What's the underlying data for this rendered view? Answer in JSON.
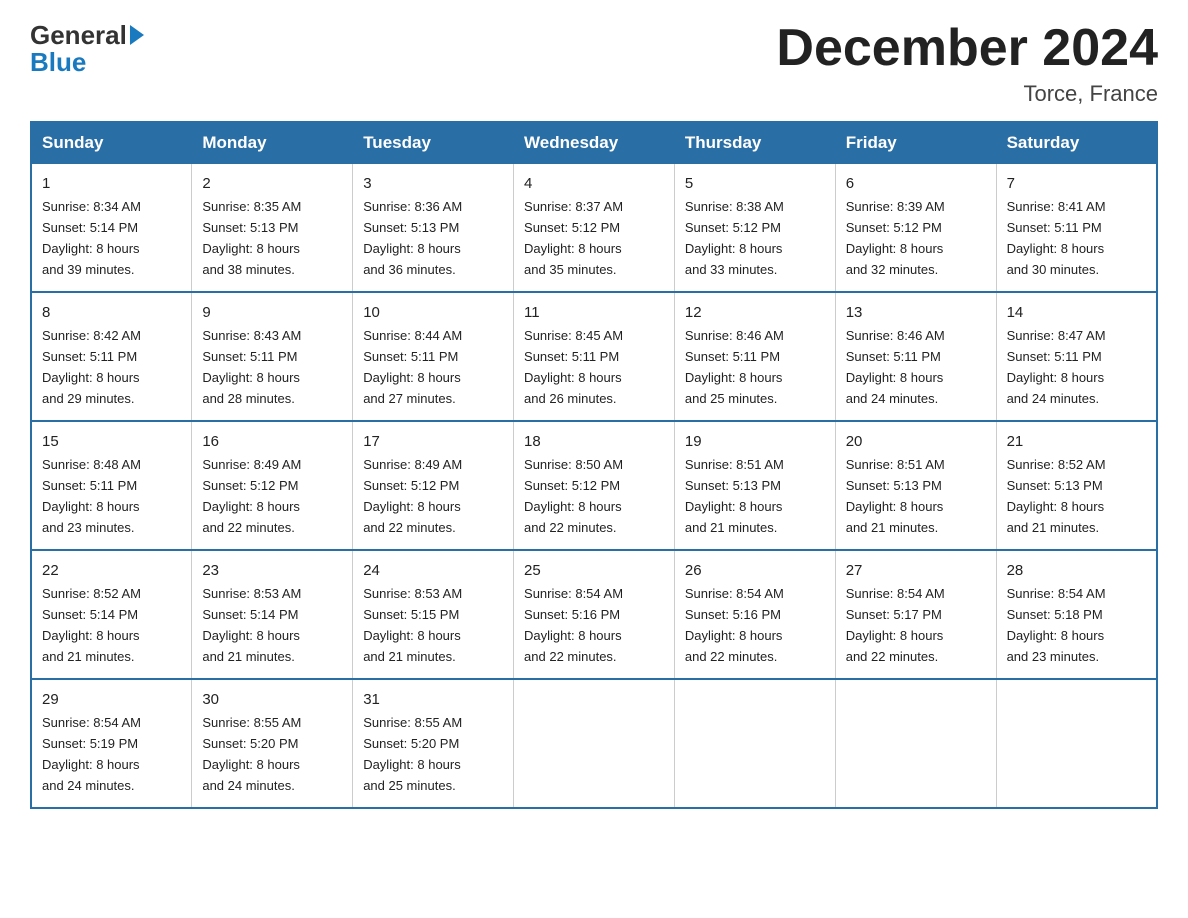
{
  "header": {
    "logo_line1": "General",
    "logo_line2": "Blue",
    "month_title": "December 2024",
    "location": "Torce, France"
  },
  "days_of_week": [
    "Sunday",
    "Monday",
    "Tuesday",
    "Wednesday",
    "Thursday",
    "Friday",
    "Saturday"
  ],
  "weeks": [
    [
      {
        "day": "1",
        "sunrise": "8:34 AM",
        "sunset": "5:14 PM",
        "daylight": "8 hours and 39 minutes."
      },
      {
        "day": "2",
        "sunrise": "8:35 AM",
        "sunset": "5:13 PM",
        "daylight": "8 hours and 38 minutes."
      },
      {
        "day": "3",
        "sunrise": "8:36 AM",
        "sunset": "5:13 PM",
        "daylight": "8 hours and 36 minutes."
      },
      {
        "day": "4",
        "sunrise": "8:37 AM",
        "sunset": "5:12 PM",
        "daylight": "8 hours and 35 minutes."
      },
      {
        "day": "5",
        "sunrise": "8:38 AM",
        "sunset": "5:12 PM",
        "daylight": "8 hours and 33 minutes."
      },
      {
        "day": "6",
        "sunrise": "8:39 AM",
        "sunset": "5:12 PM",
        "daylight": "8 hours and 32 minutes."
      },
      {
        "day": "7",
        "sunrise": "8:41 AM",
        "sunset": "5:11 PM",
        "daylight": "8 hours and 30 minutes."
      }
    ],
    [
      {
        "day": "8",
        "sunrise": "8:42 AM",
        "sunset": "5:11 PM",
        "daylight": "8 hours and 29 minutes."
      },
      {
        "day": "9",
        "sunrise": "8:43 AM",
        "sunset": "5:11 PM",
        "daylight": "8 hours and 28 minutes."
      },
      {
        "day": "10",
        "sunrise": "8:44 AM",
        "sunset": "5:11 PM",
        "daylight": "8 hours and 27 minutes."
      },
      {
        "day": "11",
        "sunrise": "8:45 AM",
        "sunset": "5:11 PM",
        "daylight": "8 hours and 26 minutes."
      },
      {
        "day": "12",
        "sunrise": "8:46 AM",
        "sunset": "5:11 PM",
        "daylight": "8 hours and 25 minutes."
      },
      {
        "day": "13",
        "sunrise": "8:46 AM",
        "sunset": "5:11 PM",
        "daylight": "8 hours and 24 minutes."
      },
      {
        "day": "14",
        "sunrise": "8:47 AM",
        "sunset": "5:11 PM",
        "daylight": "8 hours and 24 minutes."
      }
    ],
    [
      {
        "day": "15",
        "sunrise": "8:48 AM",
        "sunset": "5:11 PM",
        "daylight": "8 hours and 23 minutes."
      },
      {
        "day": "16",
        "sunrise": "8:49 AM",
        "sunset": "5:12 PM",
        "daylight": "8 hours and 22 minutes."
      },
      {
        "day": "17",
        "sunrise": "8:49 AM",
        "sunset": "5:12 PM",
        "daylight": "8 hours and 22 minutes."
      },
      {
        "day": "18",
        "sunrise": "8:50 AM",
        "sunset": "5:12 PM",
        "daylight": "8 hours and 22 minutes."
      },
      {
        "day": "19",
        "sunrise": "8:51 AM",
        "sunset": "5:13 PM",
        "daylight": "8 hours and 21 minutes."
      },
      {
        "day": "20",
        "sunrise": "8:51 AM",
        "sunset": "5:13 PM",
        "daylight": "8 hours and 21 minutes."
      },
      {
        "day": "21",
        "sunrise": "8:52 AM",
        "sunset": "5:13 PM",
        "daylight": "8 hours and 21 minutes."
      }
    ],
    [
      {
        "day": "22",
        "sunrise": "8:52 AM",
        "sunset": "5:14 PM",
        "daylight": "8 hours and 21 minutes."
      },
      {
        "day": "23",
        "sunrise": "8:53 AM",
        "sunset": "5:14 PM",
        "daylight": "8 hours and 21 minutes."
      },
      {
        "day": "24",
        "sunrise": "8:53 AM",
        "sunset": "5:15 PM",
        "daylight": "8 hours and 21 minutes."
      },
      {
        "day": "25",
        "sunrise": "8:54 AM",
        "sunset": "5:16 PM",
        "daylight": "8 hours and 22 minutes."
      },
      {
        "day": "26",
        "sunrise": "8:54 AM",
        "sunset": "5:16 PM",
        "daylight": "8 hours and 22 minutes."
      },
      {
        "day": "27",
        "sunrise": "8:54 AM",
        "sunset": "5:17 PM",
        "daylight": "8 hours and 22 minutes."
      },
      {
        "day": "28",
        "sunrise": "8:54 AM",
        "sunset": "5:18 PM",
        "daylight": "8 hours and 23 minutes."
      }
    ],
    [
      {
        "day": "29",
        "sunrise": "8:54 AM",
        "sunset": "5:19 PM",
        "daylight": "8 hours and 24 minutes."
      },
      {
        "day": "30",
        "sunrise": "8:55 AM",
        "sunset": "5:20 PM",
        "daylight": "8 hours and 24 minutes."
      },
      {
        "day": "31",
        "sunrise": "8:55 AM",
        "sunset": "5:20 PM",
        "daylight": "8 hours and 25 minutes."
      },
      null,
      null,
      null,
      null
    ]
  ],
  "labels": {
    "sunrise": "Sunrise:",
    "sunset": "Sunset:",
    "daylight": "Daylight:"
  }
}
